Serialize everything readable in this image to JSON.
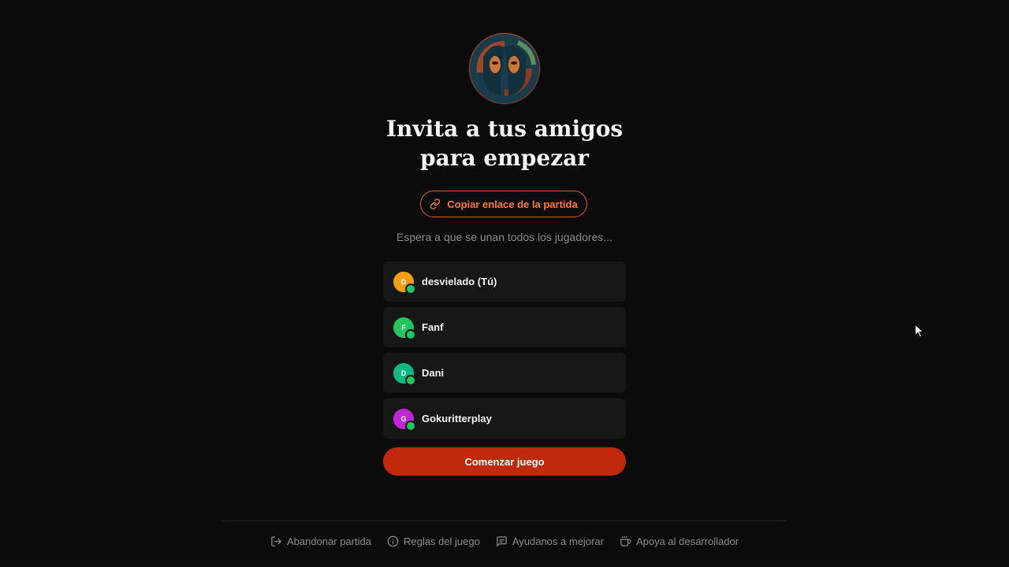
{
  "title_line1": "Invita a tus amigos",
  "title_line2": "para empezar",
  "copy_link_label": "Copiar enlace de la partida",
  "waiting_text": "Espera a que se unan todos los jugadores...",
  "players": [
    {
      "initial": "D",
      "name": "desvielado (Tú)",
      "color": "#f59e0b"
    },
    {
      "initial": "F",
      "name": "Fanf",
      "color": "#22c55e"
    },
    {
      "initial": "D",
      "name": "Dani",
      "color": "#10b981"
    },
    {
      "initial": "G",
      "name": "Gokuritterplay",
      "color": "#c026d3"
    }
  ],
  "start_button_label": "Comenzar juego",
  "footer": {
    "leave_label": "Abandonar partida",
    "rules_label": "Reglas del juego",
    "feedback_label": "Ayudanos a mejorar",
    "support_label": "Apoya al desarrollador"
  },
  "colors": {
    "accent": "#e25b1f",
    "start_button": "#c02a0b",
    "online": "#22c55e"
  }
}
